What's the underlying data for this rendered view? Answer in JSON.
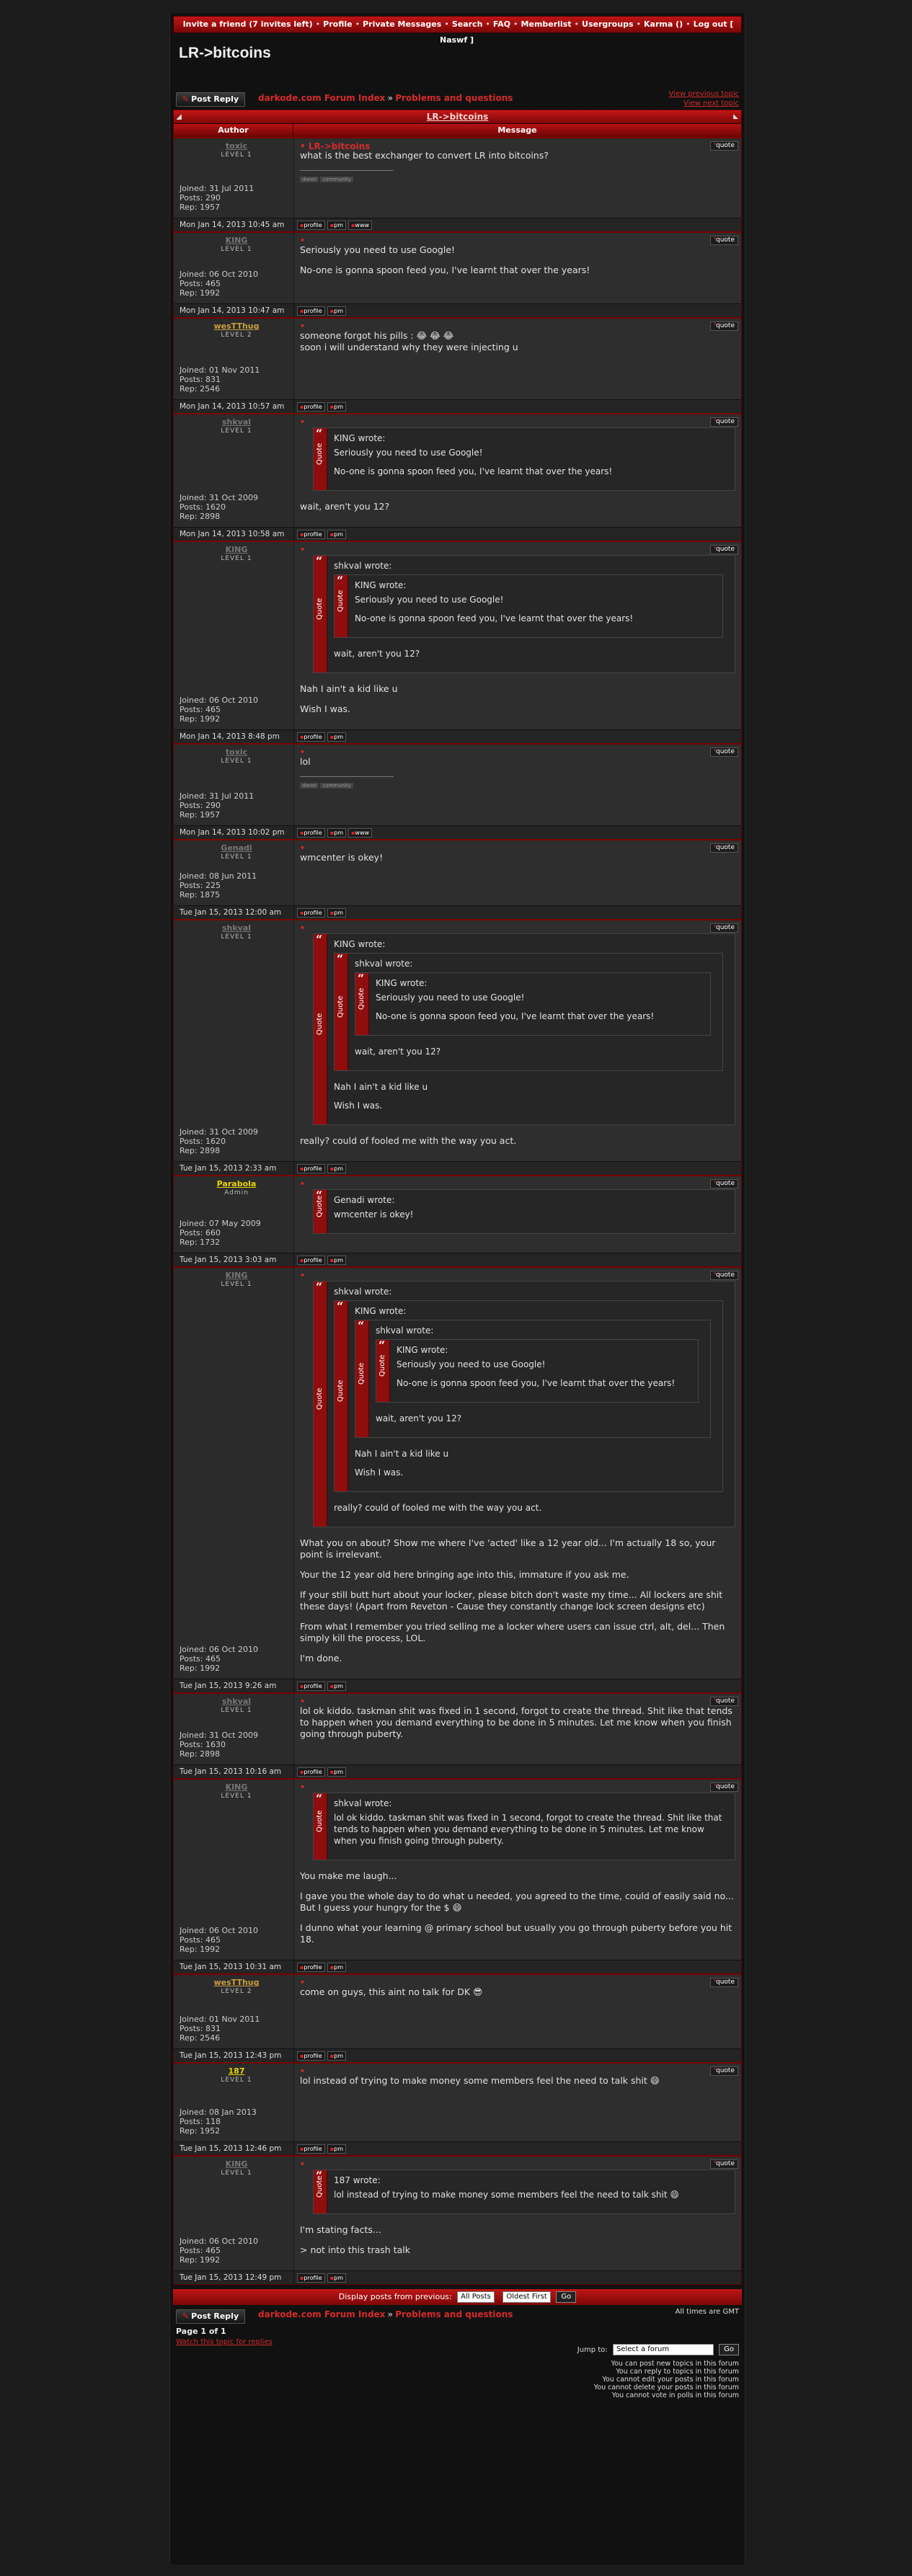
{
  "topnav": {
    "items": [
      "Invite a friend (7 invites left)",
      "Profile",
      "Private Messages",
      "Search",
      "FAQ",
      "Memberlist",
      "Usergroups",
      "Karma ()",
      "Log out [ Naswf ]"
    ],
    "separator": "•"
  },
  "title": "LR->bitcoins",
  "toolbar": {
    "post_reply": "Post Reply",
    "breadcrumb_forum": "darkode.com Forum Index",
    "breadcrumb_arrow": "»",
    "breadcrumb_section": "Problems and questions",
    "view_previous": "View previous topic",
    "view_next": "View next topic"
  },
  "table": {
    "topic_title": "LR->bitcoins",
    "col_author": "Author",
    "col_message": "Message"
  },
  "labels": {
    "joined": "Joined:",
    "posts": "Posts:",
    "rep": "Rep:",
    "quote_btn": "quote",
    "profile_btn": "profile",
    "pm_btn": "pm",
    "www_btn": "www",
    "quote_word": "Quote",
    "wrote_suffix": " wrote:",
    "subject_bullet": "•",
    "subject_title": "LR->bitcoins"
  },
  "posts": [
    {
      "author": "toxic",
      "rank": "LEVEL 1",
      "joined": "31 Jul 2011",
      "posts": "290",
      "rep": "1957",
      "name_color": "#777777",
      "time": "Mon Jan 14, 2013 10:45 am",
      "www": true,
      "first": true,
      "sig": [
        "donor",
        "community"
      ],
      "text": [
        "what is the best exchanger to convert LR into bitcoins?"
      ]
    },
    {
      "author": "KING",
      "rank": "LEVEL 1",
      "joined": "06 Oct 2010",
      "posts": "465",
      "rep": "1992",
      "name_color": "#777777",
      "time": "Mon Jan 14, 2013 10:47 am",
      "text": [
        "Seriously you need to use Google!",
        "No-one is gonna spoon feed you, I've learnt that over the years!"
      ]
    },
    {
      "author": "wesTThug",
      "rank": "LEVEL 2",
      "joined": "01 Nov 2011",
      "posts": "831",
      "rep": "2546",
      "name_color": "#c8a040",
      "time": "Mon Jan 14, 2013 10:57 am",
      "text": [
        "someone forgot his pills : 😂 😂 😂\nsoon i will understand why they were injecting u"
      ]
    },
    {
      "author": "shkval",
      "rank": "LEVEL 1",
      "joined": "31 Oct 2009",
      "posts": "1620",
      "rep": "2898",
      "name_color": "#777777",
      "time": "Mon Jan 14, 2013 10:58 am",
      "quote": {
        "who": "KING",
        "paras": [
          "Seriously you need to use Google!",
          "No-one is gonna spoon feed you, I've learnt that over the years!"
        ]
      },
      "text": [
        "wait, aren't you 12?"
      ]
    },
    {
      "author": "KING",
      "rank": "LEVEL 1",
      "joined": "06 Oct 2010",
      "posts": "465",
      "rep": "1992",
      "name_color": "#777777",
      "time": "Mon Jan 14, 2013 8:48 pm",
      "quote": {
        "who": "shkval",
        "inner": {
          "who": "KING",
          "paras": [
            "Seriously you need to use Google!",
            "No-one is gonna spoon feed you, I've learnt that over the years!"
          ]
        },
        "paras": [
          "wait, aren't you 12?"
        ]
      },
      "text": [
        "Nah I ain't a kid like u",
        "Wish I was."
      ]
    },
    {
      "author": "toxic",
      "rank": "LEVEL 1",
      "joined": "31 Jul 2011",
      "posts": "290",
      "rep": "1957",
      "name_color": "#777777",
      "time": "Mon Jan 14, 2013 10:02 pm",
      "www": true,
      "sig": [
        "donor",
        "community"
      ],
      "text": [
        "lol"
      ]
    },
    {
      "author": "Genadi",
      "rank": "LEVEL 1",
      "joined": "08 Jun 2011",
      "posts": "225",
      "rep": "1875",
      "name_color": "#777777",
      "time": "Tue Jan 15, 2013 12:00 am",
      "text": [
        "wmcenter is okey!"
      ]
    },
    {
      "author": "shkval",
      "rank": "LEVEL 1",
      "joined": "31 Oct 2009",
      "posts": "1620",
      "rep": "2898",
      "name_color": "#777777",
      "time": "Tue Jan 15, 2013 2:33 am",
      "quote": {
        "who": "KING",
        "inner": {
          "who": "shkval",
          "inner": {
            "who": "KING",
            "paras": [
              "Seriously you need to use Google!",
              "No-one is gonna spoon feed you, I've learnt that over the years!"
            ]
          },
          "paras": [
            "wait, aren't you 12?"
          ]
        },
        "paras": [
          "Nah I ain't a kid like u",
          "Wish I was."
        ]
      },
      "text": [
        "really? could of fooled me with the way you act."
      ]
    },
    {
      "author": "Parabola",
      "rank": "Admin",
      "joined": "07 May 2009",
      "posts": "660",
      "rep": "1732",
      "name_color": "#e8d400",
      "time": "Tue Jan 15, 2013 3:03 am",
      "quote": {
        "who": "Genadi",
        "paras": [
          "wmcenter is okey!"
        ]
      },
      "text": []
    },
    {
      "author": "KING",
      "rank": "LEVEL 1",
      "joined": "06 Oct 2010",
      "posts": "465",
      "rep": "1992",
      "name_color": "#777777",
      "time": "Tue Jan 15, 2013 9:26 am",
      "quote": {
        "who": "shkval",
        "inner": {
          "who": "KING",
          "inner": {
            "who": "shkval",
            "inner": {
              "who": "KING",
              "paras": [
                "Seriously you need to use Google!",
                "No-one is gonna spoon feed you, I've learnt that over the years!"
              ]
            },
            "paras": [
              "wait, aren't you 12?"
            ]
          },
          "paras": [
            "Nah I ain't a kid like u",
            "Wish I was."
          ]
        },
        "paras": [
          "really? could of fooled me with the way you act."
        ]
      },
      "text": [
        "What you on about? Show me where I've 'acted' like a 12 year old... I'm actually 18 so, your point is irrelevant.",
        "Your the 12 year old here bringing age into this, immature if you ask me.",
        "If your still butt hurt about your locker, please bitch don't waste my time... All lockers are shit these days! (Apart from Reveton - Cause they constantly change lock screen designs etc)",
        "From what I remember you tried selling me a locker where users can issue ctrl, alt, del... Then simply kill the process, LOL.",
        "I'm done."
      ]
    },
    {
      "author": "shkval",
      "rank": "LEVEL 1",
      "joined": "31 Oct 2009",
      "posts": "1630",
      "rep": "2898",
      "name_color": "#777777",
      "time": "Tue Jan 15, 2013 10:16 am",
      "text": [
        "lol ok kiddo. taskman shit was fixed in 1 second, forgot to create the thread. Shit like that tends to happen when you demand everything to be done in 5 minutes. Let me know when you finish going through puberty."
      ]
    },
    {
      "author": "KING",
      "rank": "LEVEL 1",
      "joined": "06 Oct 2010",
      "posts": "465",
      "rep": "1992",
      "name_color": "#777777",
      "time": "Tue Jan 15, 2013 10:31 am",
      "quote": {
        "who": "shkval",
        "paras": [
          "lol ok kiddo. taskman shit was fixed in 1 second, forgot to create the thread. Shit like that tends to happen when you demand everything to be done in 5 minutes. Let me know when you finish going through puberty."
        ]
      },
      "text": [
        "You make me laugh...",
        "I gave you the whole day to do what u needed, you agreed to the time, could of easily said no... But I guess your hungry for the $ 😄",
        "I dunno what your learning @ primary school but usually you go through puberty before you hit 18."
      ]
    },
    {
      "author": "wesTThug",
      "rank": "LEVEL 2",
      "joined": "01 Nov 2011",
      "posts": "831",
      "rep": "2546",
      "name_color": "#c8a040",
      "time": "Tue Jan 15, 2013 12:43 pm",
      "text": [
        "come on guys, this aint no talk for DK 😎"
      ]
    },
    {
      "author": "187",
      "rank": "LEVEL 1",
      "joined": "08 Jan 2013",
      "posts": "118",
      "rep": "1952",
      "name_color": "#e8d400",
      "time": "Tue Jan 15, 2013 12:46 pm",
      "text": [
        "lol instead of trying to make money some members feel the need to talk shit 😄"
      ]
    },
    {
      "author": "KING",
      "rank": "LEVEL 1",
      "joined": "06 Oct 2010",
      "posts": "465",
      "rep": "1992",
      "name_color": "#777777",
      "time": "Tue Jan 15, 2013 12:49 pm",
      "quote": {
        "who": "187",
        "paras": [
          "lol instead of trying to make money some members feel the need to talk shit 😄"
        ]
      },
      "text": [
        "I'm stating facts...",
        "> not into this trash talk"
      ]
    }
  ],
  "display_bar": {
    "label": "Display posts from previous:",
    "range": "All Posts",
    "order": "Oldest First",
    "go": "Go"
  },
  "footer": {
    "timezone": "All times are GMT",
    "page": "Page 1 of 1",
    "watch": "Watch this topic for replies",
    "jump_label": "Jump to:",
    "jump_placeholder": "Select a forum",
    "jump_go": "Go",
    "permissions": [
      "You can post new topics in this forum",
      "You can reply to topics in this forum",
      "You cannot edit your posts in this forum",
      "You cannot delete your posts in this forum",
      "You cannot vote in polls in this forum"
    ]
  }
}
